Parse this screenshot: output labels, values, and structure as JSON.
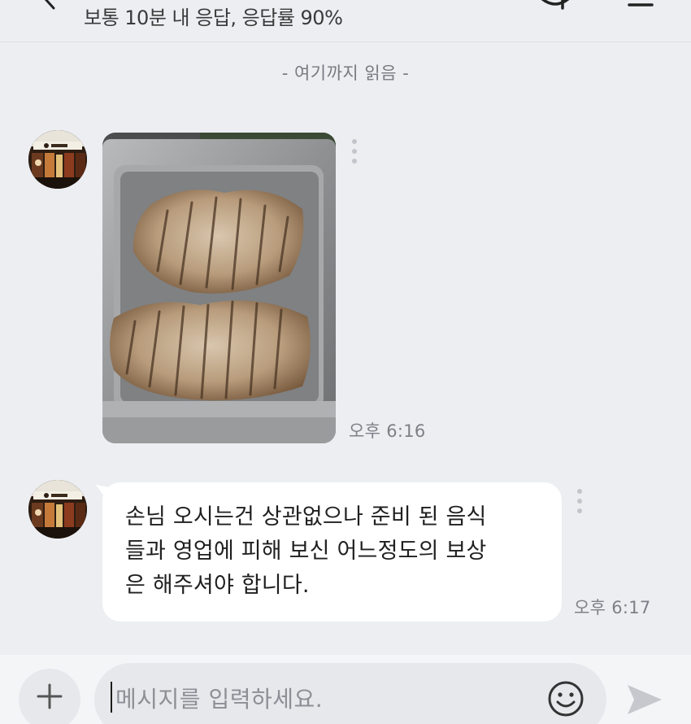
{
  "header": {
    "subtitle": "보통 10분 내 응답, 응답률 90%"
  },
  "chat": {
    "read_marker": "- 여기까지 읽음 -",
    "messages": [
      {
        "type": "image",
        "time": "오후 6:16"
      },
      {
        "type": "text",
        "lines": [
          "손님 오시는건 상관없으나 준비 된 음식",
          "들과 영업에 피해 보신 어느정도의 보상",
          "은 해주셔야 합니다."
        ],
        "time": "오후 6:17"
      }
    ]
  },
  "input": {
    "placeholder": "메시지를 입력하세요."
  },
  "colors": {
    "background": "#eceef2",
    "bubble": "#ffffff",
    "input_bar": "#f4f5f7",
    "muted_text": "#7d8086"
  }
}
